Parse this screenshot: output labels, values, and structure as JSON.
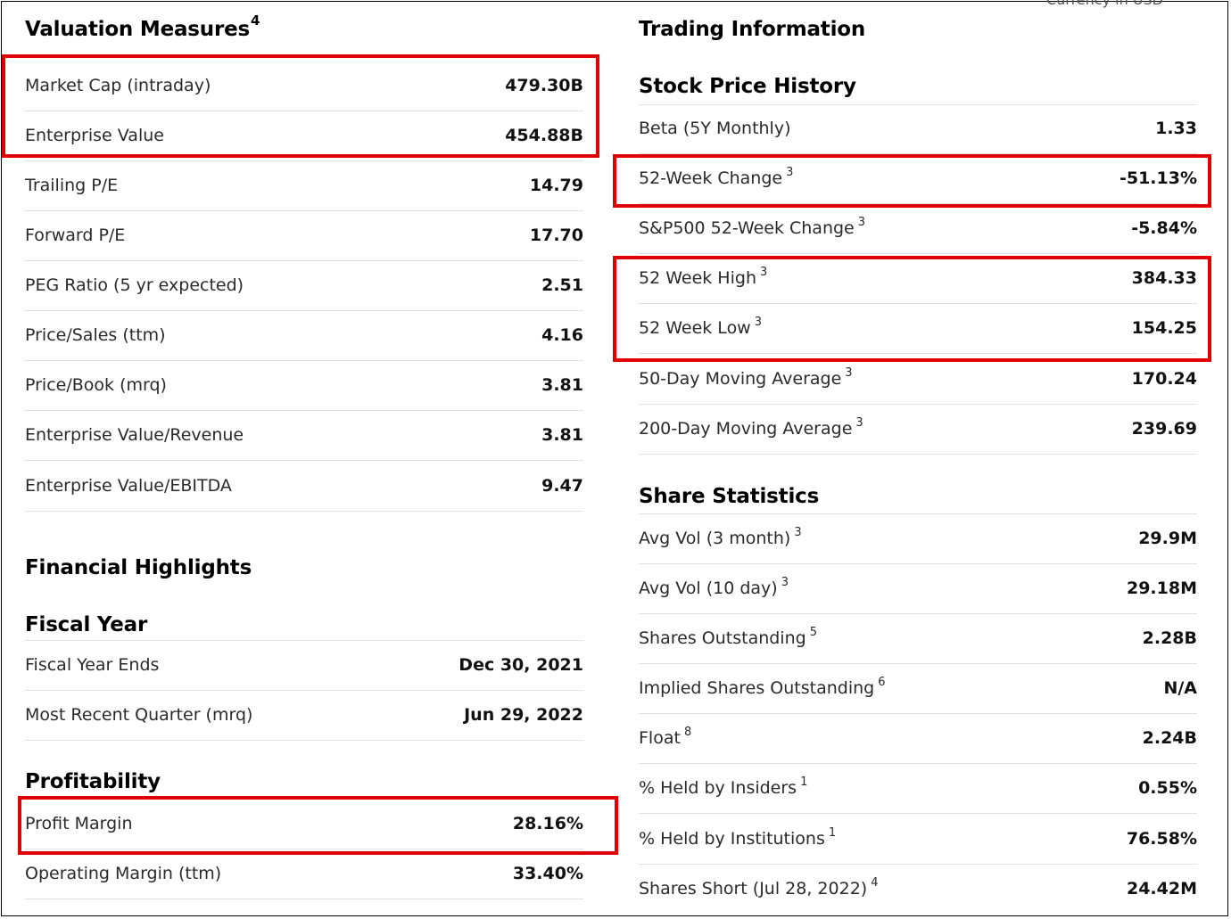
{
  "currency_note": "Currency in USD",
  "valuation": {
    "title": "Valuation Measures",
    "title_sup": "4",
    "rows": [
      {
        "label": "Market Cap (intraday)",
        "value": "479.30B"
      },
      {
        "label": "Enterprise Value",
        "value": "454.88B"
      },
      {
        "label": "Trailing P/E",
        "value": "14.79"
      },
      {
        "label": "Forward P/E",
        "value": "17.70"
      },
      {
        "label": "PEG Ratio (5 yr expected)",
        "value": "2.51"
      },
      {
        "label": "Price/Sales (ttm)",
        "value": "4.16"
      },
      {
        "label": "Price/Book (mrq)",
        "value": "3.81"
      },
      {
        "label": "Enterprise Value/Revenue",
        "value": "3.81"
      },
      {
        "label": "Enterprise Value/EBITDA",
        "value": "9.47"
      }
    ]
  },
  "financial": {
    "title": "Financial Highlights",
    "fiscal_year": {
      "title": "Fiscal Year",
      "rows": [
        {
          "label": "Fiscal Year Ends",
          "value": "Dec 30, 2021"
        },
        {
          "label": "Most Recent Quarter (mrq)",
          "value": "Jun 29, 2022"
        }
      ]
    },
    "profitability": {
      "title": "Profitability",
      "rows": [
        {
          "label": "Profit Margin",
          "value": "28.16%"
        },
        {
          "label": "Operating Margin (ttm)",
          "value": "33.40%"
        }
      ]
    }
  },
  "trading": {
    "title": "Trading Information",
    "price_history": {
      "title": "Stock Price History",
      "rows": [
        {
          "label": "Beta (5Y Monthly)",
          "sup": "",
          "value": "1.33"
        },
        {
          "label": "52-Week Change",
          "sup": "3",
          "value": "-51.13%"
        },
        {
          "label": "S&P500 52-Week Change",
          "sup": "3",
          "value": "-5.84%"
        },
        {
          "label": "52 Week High",
          "sup": "3",
          "value": "384.33"
        },
        {
          "label": "52 Week Low",
          "sup": "3",
          "value": "154.25"
        },
        {
          "label": "50-Day Moving Average",
          "sup": "3",
          "value": "170.24"
        },
        {
          "label": "200-Day Moving Average",
          "sup": "3",
          "value": "239.69"
        }
      ]
    },
    "share_stats": {
      "title": "Share Statistics",
      "rows": [
        {
          "label": "Avg Vol (3 month)",
          "sup": "3",
          "value": "29.9M"
        },
        {
          "label": "Avg Vol (10 day)",
          "sup": "3",
          "value": "29.18M"
        },
        {
          "label": "Shares Outstanding",
          "sup": "5",
          "value": "2.28B"
        },
        {
          "label": "Implied Shares Outstanding",
          "sup": "6",
          "value": "N/A"
        },
        {
          "label": "Float",
          "sup": "8",
          "value": "2.24B"
        },
        {
          "label": "% Held by Insiders",
          "sup": "1",
          "value": "0.55%"
        },
        {
          "label": "% Held by Institutions",
          "sup": "1",
          "value": "76.58%"
        },
        {
          "label": "Shares Short (Jul 28, 2022)",
          "sup": "4",
          "value": "24.42M"
        }
      ]
    }
  },
  "highlight_color": "#e00000"
}
